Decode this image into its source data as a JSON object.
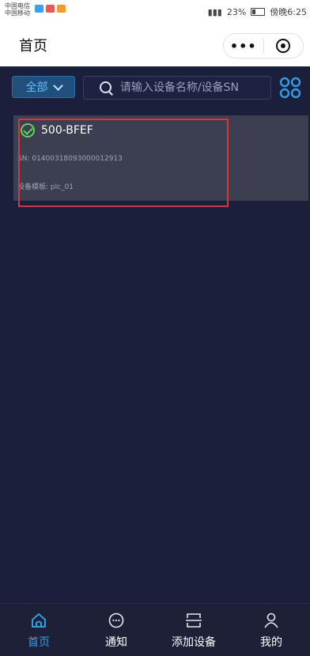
{
  "status_bar": {
    "carrier_1": "中国电信",
    "carrier_2": "中国移动",
    "battery": "23%",
    "time": "傍晚6:25"
  },
  "header": {
    "title": "首页",
    "more": "•••"
  },
  "toolbar": {
    "filter_label": "全部",
    "search_placeholder": "请输入设备名称/设备SN"
  },
  "devices": [
    {
      "name": "500-BFEF",
      "sn": "SN: 01400318093000012913",
      "template": "设备模板: plc_01",
      "status": "online"
    }
  ],
  "tabs": [
    {
      "label": "首页",
      "icon": "home-icon",
      "active": true
    },
    {
      "label": "通知",
      "icon": "chat-icon",
      "active": false
    },
    {
      "label": "添加设备",
      "icon": "scan-icon",
      "active": false
    },
    {
      "label": "我的",
      "icon": "user-icon",
      "active": false
    }
  ],
  "colors": {
    "background": "#1b1f3c",
    "accent": "#2e9fe6",
    "card": "#3c3e52",
    "online": "#5ed35e",
    "highlight": "#d23a3a"
  }
}
